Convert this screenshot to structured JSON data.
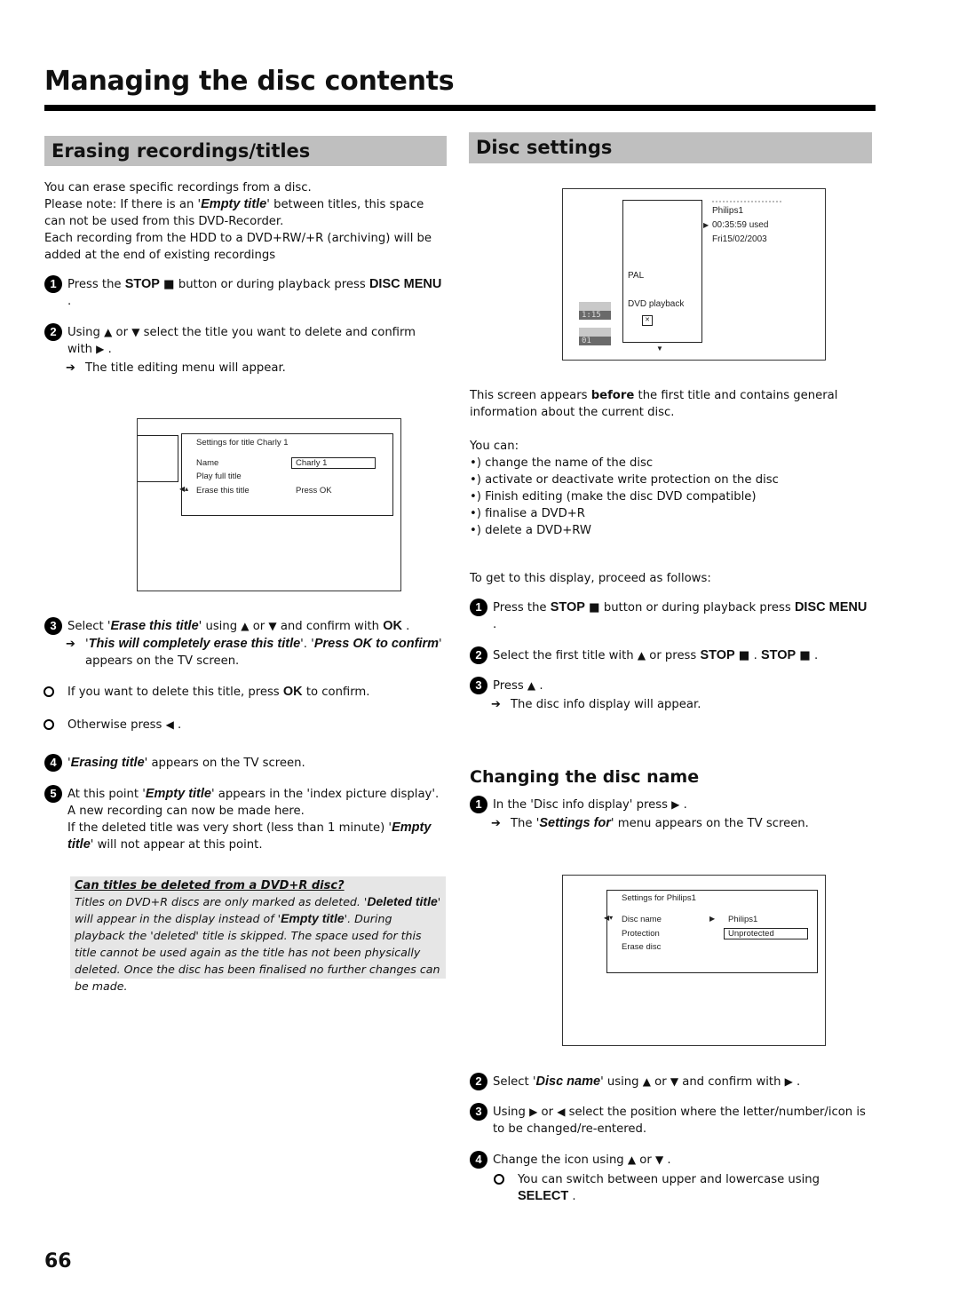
{
  "page": {
    "title": "Managing the disc contents",
    "page_number": "66"
  },
  "left": {
    "section_title": "Erasing recordings/titles",
    "intro": {
      "line1": "You can erase specific recordings from a disc.",
      "line2_pre": "Please note: If there is an '",
      "line2_em": "Empty title",
      "line2_post": "' between titles, this space can not be used from this DVD-Recorder.",
      "line3": "Each recording from the HDD to a DVD+RW/+R (archiving) will be added at the end of existing recordings"
    },
    "step1": {
      "num": "1",
      "pre": "Press the ",
      "key1": "STOP",
      "mid": " button or during playback press ",
      "key2": "DISC MENU",
      "post": " ."
    },
    "step2": {
      "num": "2",
      "pre": "Using ",
      "or": " or ",
      "mid": " select the title you want to delete and confirm with ",
      "post": " .",
      "result": "The title editing menu will appear."
    },
    "tv_screen": {
      "heading": "Settings for title Charly 1",
      "rows": [
        {
          "label": "Name",
          "value": "Charly 1",
          "boxed": true
        },
        {
          "label": "Play full title",
          "value": "",
          "boxed": false
        },
        {
          "label": "Erase this title",
          "value": "Press OK",
          "boxed": false,
          "selected": true
        }
      ]
    },
    "step3": {
      "num": "3",
      "pre": "Select '",
      "em": "Erase this title",
      "mid": "' using ",
      "or": " or ",
      "post": " and confirm with ",
      "key": "OK",
      "end": " .",
      "result_pre": "'",
      "result_em1": "This will completely erase this title",
      "result_mid": "'. '",
      "result_em2": "Press OK to confirm",
      "result_post": "' appears on the TV screen.",
      "option1_pre": "If you want to delete this title, press ",
      "option1_key": "OK",
      "option1_post": " to confirm.",
      "option2_pre": "Otherwise press ",
      "option2_post": " ."
    },
    "step4": {
      "num": "4",
      "pre": "'",
      "em": "Erasing title",
      "post": "' appears on the TV screen."
    },
    "step5": {
      "num": "5",
      "pre": "At this point '",
      "em": "Empty title",
      "post": "' appears in the 'index picture display'. A new recording can now be made here.",
      "line2_pre": "If the deleted title was very short (less than 1 minute) '",
      "line2_em": "Empty title",
      "line2_post": "' will not appear at this point."
    },
    "note": {
      "title": "Can titles be deleted from a DVD+R disc?",
      "body_pre": "Titles on DVD+R discs are only marked as deleted. '",
      "body_em1": "Deleted title",
      "body_mid": "' will appear in the display instead of '",
      "body_em2": "Empty title",
      "body_post": "'. During playback the 'deleted' title is skipped. The space used for this title cannot be used again as the title has not been physically deleted. Once the disc has been finalised no further changes can be made."
    }
  },
  "right": {
    "section_title": "Disc settings",
    "tv_info": {
      "disc_name": "Philips1",
      "used": "00:35:59 used",
      "date": "Fri15/02/2003",
      "format": "PAL",
      "mode": "DVD playback",
      "badge1": "1:15",
      "badge2": "01"
    },
    "intro_pre": "This screen appears ",
    "intro_bold": "before",
    "intro_post": " the first title and contains general information about the current disc.",
    "you_can": "You can:",
    "bullets": [
      "•) change the name of the disc",
      "•) activate or deactivate write protection on the disc",
      "•) Finish editing (make the disc DVD compatible)",
      "•) finalise a DVD+R",
      "•) delete a DVD+RW"
    ],
    "proceed": "To get to this display, proceed as follows:",
    "step1": {
      "num": "1",
      "pre": "Press the ",
      "key1": "STOP",
      "mid": " button or during playback press ",
      "key2": "DISC MENU",
      "post": " ."
    },
    "step2": {
      "num": "2",
      "pre": "Select the first title with ",
      "mid": " or press ",
      "key1": "STOP",
      "sep": " . ",
      "key2": "STOP",
      "post": " ."
    },
    "step3": {
      "num": "3",
      "pre": "Press ",
      "post": " .",
      "result": "The disc info display will appear."
    },
    "subsection_title": "Changing the disc name",
    "cstep1": {
      "num": "1",
      "pre": "In the 'Disc info display' press ",
      "post": " .",
      "result_pre": "The '",
      "result_em": "Settings for",
      "result_post": "' menu appears on the TV screen."
    },
    "tv_settings": {
      "heading": "Settings for Philips1",
      "rows": [
        {
          "label": "Disc name",
          "value": "Philips1",
          "boxed": false,
          "selected": true
        },
        {
          "label": "Protection",
          "value": "Unprotected",
          "boxed": true
        },
        {
          "label": "Erase disc",
          "value": "",
          "boxed": false
        }
      ]
    },
    "cstep2": {
      "num": "2",
      "pre": "Select '",
      "em": "Disc name",
      "mid": "' using ",
      "or": " or ",
      "post": " and confirm with ",
      "end": " ."
    },
    "cstep3": {
      "num": "3",
      "pre": "Using ",
      "or": " or ",
      "post": " select the position where the letter/number/icon is to be changed/re-entered."
    },
    "cstep4": {
      "num": "4",
      "pre": "Change the icon using ",
      "or": " or ",
      "post": " .",
      "tip_pre": "You can switch between upper and lowercase using ",
      "tip_key": "SELECT",
      "tip_post": " ."
    }
  }
}
